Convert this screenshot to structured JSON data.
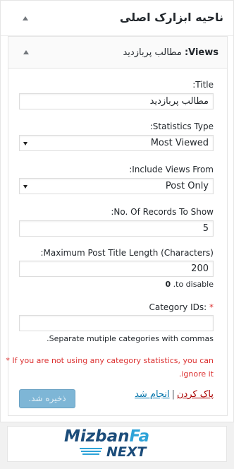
{
  "sidebar": {
    "title": "ناحیه ابزارک اصلی"
  },
  "widget": {
    "title_bold": "Views:",
    "title_sub": "مطالب پربازدید",
    "fields": {
      "title_label": ":Title",
      "title_value": "مطالب پربازدید",
      "stat_type_label": ":Statistics Type",
      "stat_type_value": "Most Viewed",
      "include_label": ":Include Views From",
      "include_value": "Post Only",
      "records_label": ":No. Of Records To Show",
      "records_value": "5",
      "maxlen_label": ":Maximum Post Title Length (Characters)",
      "maxlen_value": "200",
      "maxlen_hint_num": "0",
      "maxlen_hint_text": ".to disable",
      "category_label": "Category IDs:",
      "category_required": "*",
      "category_value": "",
      "category_hint": ".Separate mutiple categories with commas",
      "warning_line1": "* If you are not using any category statistics, you can",
      "warning_line2": ".ignore it"
    },
    "actions": {
      "delete": "پاک کردن",
      "separator": "|",
      "done": "انجام شد",
      "save": "ذخیره شد."
    }
  },
  "logo": {
    "top_main": "Mizban",
    "top_accent": "Fa",
    "bottom": "NEXT"
  },
  "colors": {
    "primary_button": "#7eb6d6",
    "link": "#0073aa",
    "delete_link": "#a00000",
    "warning": "#dc3232",
    "logo_dark": "#1b4c7a",
    "logo_light": "#2ea3d8"
  }
}
